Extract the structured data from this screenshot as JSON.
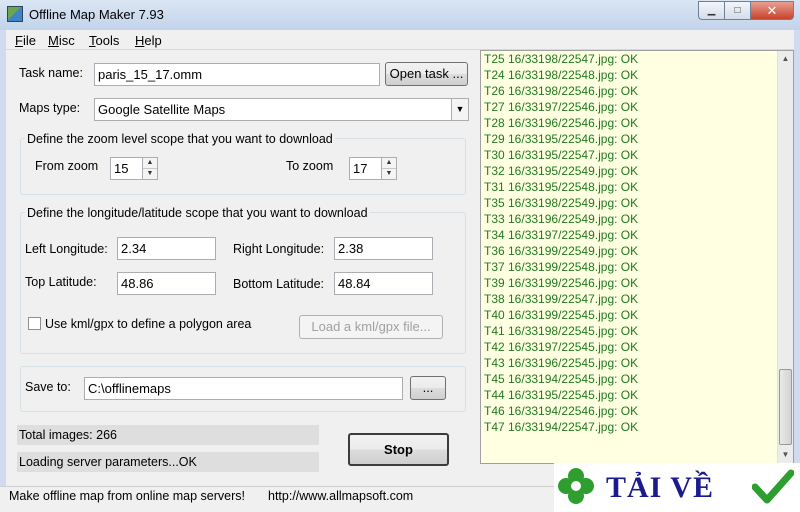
{
  "window": {
    "title": "Offline Map Maker 7.93"
  },
  "menu": [
    {
      "label": "File",
      "accel": "F",
      "rest": "ile"
    },
    {
      "label": "Misc",
      "accel": "M",
      "rest": "isc"
    },
    {
      "label": "Tools",
      "accel": "T",
      "rest": "ools"
    },
    {
      "label": "Help",
      "accel": "H",
      "rest": "elp"
    }
  ],
  "task": {
    "label": "Task name:",
    "value": "paris_15_17.omm",
    "open_label": "Open task ..."
  },
  "maps_type": {
    "label": "Maps type:",
    "value": "Google Satellite Maps"
  },
  "zoom": {
    "group_title": "Define the zoom level scope that you want to download",
    "from_label": "From zoom",
    "from_value": "15",
    "to_label": "To zoom",
    "to_value": "17"
  },
  "lonlat": {
    "group_title": "Define the longitude/latitude scope that you want to download",
    "left_label": "Left Longitude:",
    "left_value": "2.34",
    "right_label": "Right Longitude:",
    "right_value": "2.38",
    "top_label": "Top Latitude:",
    "top_value": "48.86",
    "bottom_label": "Bottom Latitude:",
    "bottom_value": "48.84",
    "kml_label": "Use kml/gpx to define a polygon area",
    "kml_checked": false,
    "load_label": "Load a kml/gpx file..."
  },
  "save": {
    "label": "Save to:",
    "value": "C:\\offlinemaps",
    "browse_label": "..."
  },
  "progress": {
    "total": "Total images: 266",
    "status": "Loading server parameters...OK"
  },
  "stop_label": "Stop",
  "log": [
    "T25 16/33198/22547.jpg: OK",
    "T24 16/33198/22548.jpg: OK",
    "T26 16/33198/22546.jpg: OK",
    "T27 16/33197/22546.jpg: OK",
    "T28 16/33196/22546.jpg: OK",
    "T29 16/33195/22546.jpg: OK",
    "T30 16/33195/22547.jpg: OK",
    "T32 16/33195/22549.jpg: OK",
    "T31 16/33195/22548.jpg: OK",
    "T35 16/33198/22549.jpg: OK",
    "T33 16/33196/22549.jpg: OK",
    "T34 16/33197/22549.jpg: OK",
    "T36 16/33199/22549.jpg: OK",
    "T37 16/33199/22548.jpg: OK",
    "T39 16/33199/22546.jpg: OK",
    "T38 16/33199/22547.jpg: OK",
    "T40 16/33199/22545.jpg: OK",
    "T41 16/33198/22545.jpg: OK",
    "T42 16/33197/22545.jpg: OK",
    "T43 16/33196/22545.jpg: OK",
    "T45 16/33194/22545.jpg: OK",
    "T44 16/33195/22545.jpg: OK",
    "T46 16/33194/22546.jpg: OK",
    "T47 16/33194/22547.jpg: OK"
  ],
  "statusbar": {
    "message": "Make offline map from online map servers!",
    "url": "http://www.allmapsoft.com"
  },
  "watermark": {
    "text": "TẢI VỀ"
  },
  "colors": {
    "log_text": "#1f7a1f",
    "log_bg": "#ffffe1",
    "watermark_text": "#1b1b8f",
    "check": "#2e9e2e"
  }
}
